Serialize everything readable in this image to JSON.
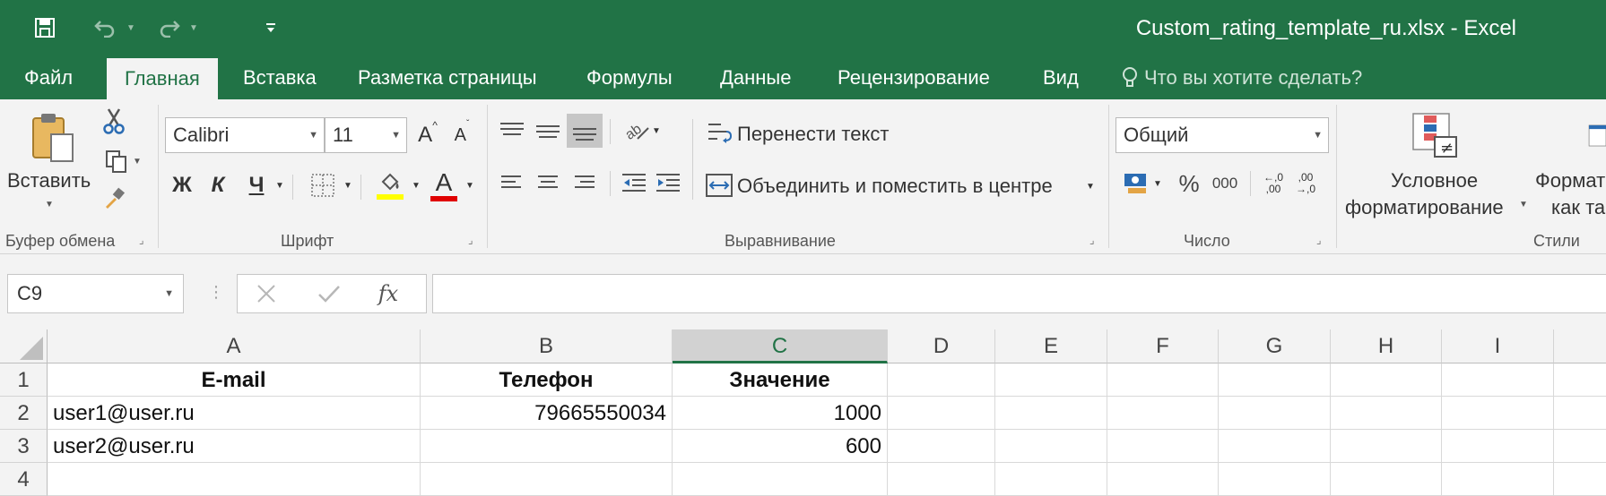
{
  "window": {
    "title": "Custom_rating_template_ru.xlsx - Excel"
  },
  "tabs": [
    {
      "label": "Файл"
    },
    {
      "label": "Главная"
    },
    {
      "label": "Вставка"
    },
    {
      "label": "Разметка страницы"
    },
    {
      "label": "Формулы"
    },
    {
      "label": "Данные"
    },
    {
      "label": "Рецензирование"
    },
    {
      "label": "Вид"
    }
  ],
  "tell_me": {
    "placeholder": "Что вы хотите сделать?"
  },
  "ribbon": {
    "clipboard": {
      "paste_label": "Вставить",
      "group_label": "Буфер обмена"
    },
    "font": {
      "name": "Calibri",
      "size": "11",
      "bold": "Ж",
      "italic": "К",
      "underline": "Ч",
      "font_color_glyph": "A",
      "grow_glyph": "A",
      "shrink_glyph": "A",
      "group_label": "Шрифт",
      "highlight_color": "#ffff00",
      "font_color": "#e00000"
    },
    "alignment": {
      "wrap_text": "Перенести текст",
      "merge_center": "Объединить и поместить в центре",
      "group_label": "Выравнивание"
    },
    "number": {
      "format": "Общий",
      "percent": "%",
      "thousands": "000",
      "inc_decimal": "←,0 ,00",
      "dec_decimal": ",00 →,0",
      "group_label": "Число"
    },
    "styles": {
      "conditional_line1": "Условное",
      "conditional_line2": "форматирование",
      "format_table_line1": "Формат",
      "format_table_line2": "как та",
      "group_label": "Стили"
    }
  },
  "formula_bar": {
    "name_box": "C9",
    "fx": "fx",
    "value": ""
  },
  "grid": {
    "columns": [
      "A",
      "B",
      "C",
      "D",
      "E",
      "F",
      "G",
      "H",
      "I"
    ],
    "rows": [
      "1",
      "2",
      "3",
      "4"
    ],
    "cells": {
      "A1": "E-mail",
      "B1": "Телефон",
      "C1": "Значение",
      "A2": "user1@user.ru",
      "B2": "79665550034",
      "C2": "1000",
      "A3": "user2@user.ru",
      "B3": "",
      "C3": "600"
    }
  },
  "colors": {
    "accent": "#217346",
    "ribbon_bg": "#f3f3f3"
  }
}
